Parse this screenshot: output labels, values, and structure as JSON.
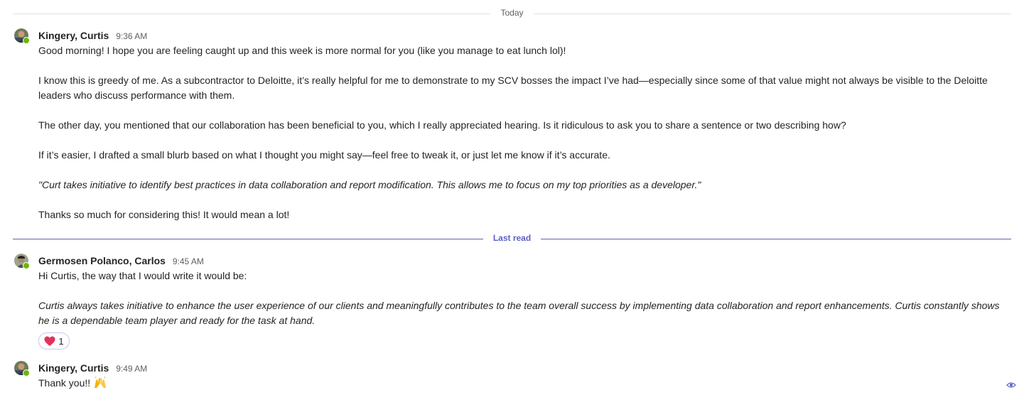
{
  "dividers": {
    "today": "Today",
    "last_read": "Last read"
  },
  "messages": [
    {
      "author": "Kingery, Curtis",
      "time": "9:36 AM",
      "paragraphs": [
        "Good morning! I hope you are feeling caught up and this week is more normal for you (like you manage to eat lunch lol)!",
        "I know this is greedy of me. As a subcontractor to Deloitte, it’s really helpful for me to demonstrate to my SCV bosses the impact I’ve had—especially since some of that value might not always be visible to the Deloitte leaders who discuss performance with them.",
        "The other day, you mentioned that our collaboration has been beneficial to you, which I really appreciated hearing. Is it ridiculous to ask you to share a sentence or two describing how?",
        "If it’s easier, I drafted a small blurb based on what I thought you might say—feel free to tweak it, or just let me know if it’s accurate.",
        "\"Curt takes initiative to identify best practices in data collaboration and report modification. This allows me to focus on my top priorities as a developer.\"",
        "Thanks so much for considering this! It would mean a lot!"
      ]
    },
    {
      "author": "Germosen Polanco, Carlos",
      "time": "9:45 AM",
      "paragraphs": [
        "Hi Curtis, the way that I would write it would be:",
        "Curtis always takes initiative to enhance the user experience of our clients and meaningfully contributes to the team overall success by implementing data collaboration and report enhancements. Curtis constantly shows he is a dependable team player and ready for the task at hand."
      ],
      "reaction": {
        "icon": "heart-icon",
        "count": "1"
      }
    },
    {
      "author": "Kingery, Curtis",
      "time": "9:49 AM",
      "text": "Thank you!!",
      "emoji_icon": "raised-hands-icon"
    }
  ],
  "colors": {
    "accent": "#5b5fc7",
    "presence": "#6bb700",
    "heart": "#e3325a"
  }
}
